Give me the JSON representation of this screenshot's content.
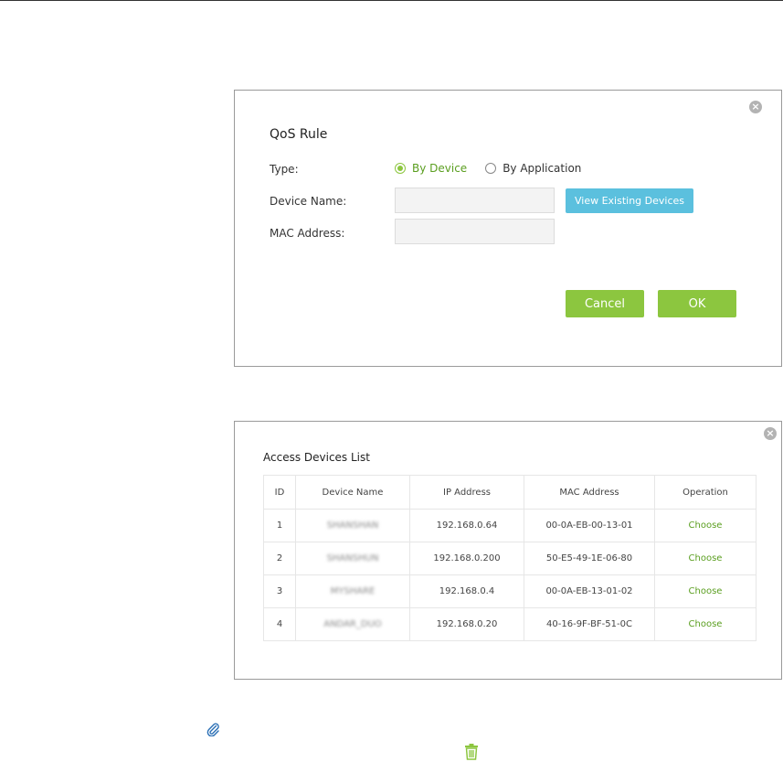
{
  "qos_rule": {
    "title": "QoS Rule",
    "type_label": "Type:",
    "type_options": [
      {
        "label": "By Device",
        "checked": true
      },
      {
        "label": "By Application",
        "checked": false
      }
    ],
    "device_name_label": "Device Name:",
    "device_name_value": "",
    "mac_address_label": "MAC Address:",
    "mac_address_value": "",
    "view_devices_label": "View Existing Devices",
    "cancel_label": "Cancel",
    "ok_label": "OK",
    "close_icon": "close-icon"
  },
  "access_devices": {
    "title": "Access Devices List",
    "columns": [
      "ID",
      "Device Name",
      "IP Address",
      "MAC Address",
      "Operation"
    ],
    "rows": [
      {
        "id": "1",
        "name": "SHANSHAN",
        "ip": "192.168.0.64",
        "mac": "00-0A-EB-00-13-01",
        "op": "Choose"
      },
      {
        "id": "2",
        "name": "SHANSHUN",
        "ip": "192.168.0.200",
        "mac": "50-E5-49-1E-06-80",
        "op": "Choose"
      },
      {
        "id": "3",
        "name": "MYSHARE",
        "ip": "192.168.0.4",
        "mac": "00-0A-EB-13-01-02",
        "op": "Choose"
      },
      {
        "id": "4",
        "name": "ANDAR_DUO",
        "ip": "192.168.0.20",
        "mac": "40-16-9F-BF-51-0C",
        "op": "Choose"
      }
    ],
    "close_icon": "close-icon"
  },
  "icons": {
    "attachment": "paperclip-icon",
    "delete": "trash-icon"
  },
  "colors": {
    "accent_green": "#8cc63f",
    "accent_blue": "#5bc0de",
    "link_green": "#5a9e1f"
  }
}
